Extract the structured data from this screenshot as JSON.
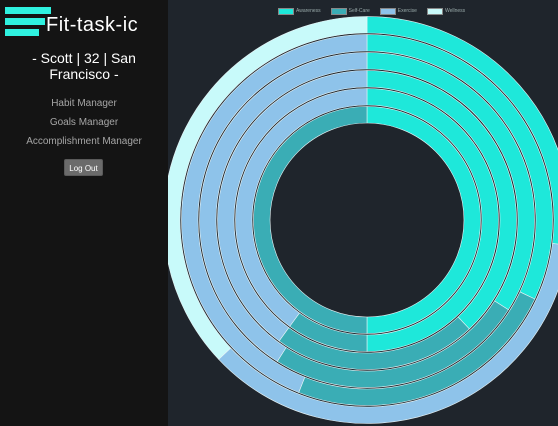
{
  "app": {
    "title": "Fit-task-ic"
  },
  "user": {
    "info": "- Scott | 32 | San Francisco -"
  },
  "nav": {
    "items": [
      {
        "label": "Habit Manager"
      },
      {
        "label": "Goals Manager"
      },
      {
        "label": "Accomplishment Manager"
      }
    ]
  },
  "actions": {
    "logout_label": "Log Out"
  },
  "colors": {
    "sidebar_bg": "#141414",
    "main_bg": "#1f252c",
    "brand_accent": "#2ff2e0"
  },
  "chart_data": {
    "type": "pie",
    "variant": "concentric-rings",
    "legend": [
      {
        "name": "Awareness",
        "color": "#1ee8da"
      },
      {
        "name": "Self-Care",
        "color": "#3aadb5"
      },
      {
        "name": "Exercise",
        "color": "#8ec3ea"
      },
      {
        "name": "Wellness",
        "color": "#c8fafa"
      }
    ],
    "legend_position": "top-center",
    "rings": [
      {
        "segments": [
          {
            "category": "Awareness",
            "fraction": 0.5
          },
          {
            "category": "Self-Care",
            "fraction": 0.5
          }
        ]
      },
      {
        "segments": [
          {
            "category": "Awareness",
            "fraction": 0.5
          },
          {
            "category": "Self-Care",
            "fraction": 0.1
          },
          {
            "category": "Exercise",
            "fraction": 0.4
          }
        ]
      },
      {
        "segments": [
          {
            "category": "Awareness",
            "fraction": 0.38
          },
          {
            "category": "Self-Care",
            "fraction": 0.22
          },
          {
            "category": "Exercise",
            "fraction": 0.4
          }
        ]
      },
      {
        "segments": [
          {
            "category": "Awareness",
            "fraction": 0.34
          },
          {
            "category": "Self-Care",
            "fraction": 0.25
          },
          {
            "category": "Exercise",
            "fraction": 0.41
          }
        ]
      },
      {
        "segments": [
          {
            "category": "Awareness",
            "fraction": 0.32
          },
          {
            "category": "Self-Care",
            "fraction": 0.24
          },
          {
            "category": "Exercise",
            "fraction": 0.44
          }
        ]
      },
      {
        "segments": [
          {
            "category": "Awareness",
            "fraction": 0.27
          },
          {
            "category": "Exercise",
            "fraction": 0.36
          },
          {
            "category": "Wellness",
            "fraction": 0.37
          }
        ]
      }
    ]
  }
}
